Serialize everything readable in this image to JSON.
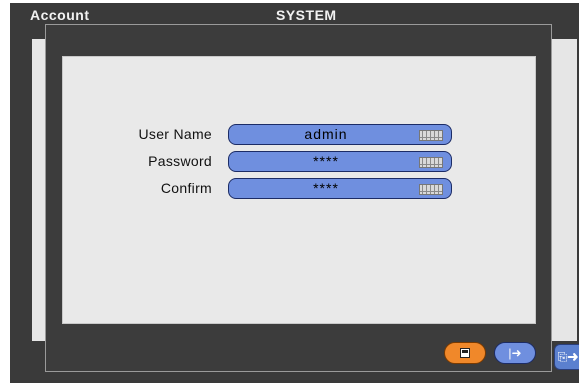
{
  "background_window": {
    "left_title": "Account",
    "title": "SYSTEM",
    "exit_icon": "exit-arrow-icon"
  },
  "dialog": {
    "fields": [
      {
        "label": "User Name",
        "value": "admin",
        "icon": "keyboard-icon"
      },
      {
        "label": "Password",
        "value": "****",
        "icon": "keyboard-icon"
      },
      {
        "label": "Confirm",
        "value": "****",
        "icon": "keyboard-icon"
      }
    ],
    "buttons": {
      "save_icon": "save-icon",
      "exit_icon": "exit-arrow-icon"
    }
  },
  "colors": {
    "field_blue": "#6f8fdf",
    "save_orange": "#f0882a",
    "window_dark": "#3c3c3c",
    "panel_gray": "#e9e9e9"
  }
}
